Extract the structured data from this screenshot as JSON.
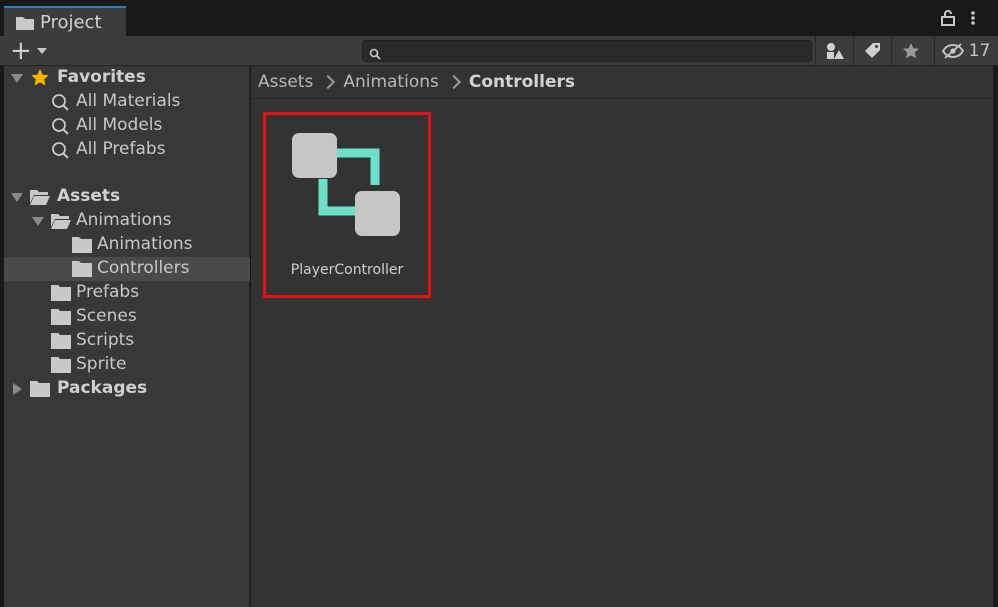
{
  "window": {
    "tab_title": "Project",
    "icons": [
      "folder-icon",
      "lock-icon",
      "kebab-menu-icon"
    ]
  },
  "toolbar": {
    "add_button": "+",
    "search": {
      "value": "",
      "placeholder": ""
    },
    "buttons": [
      "filter-by-type-icon",
      "filter-by-label-icon",
      "favorites-star-icon"
    ],
    "hidden_packages_count": "17"
  },
  "sidebar": {
    "favorites": {
      "label": "Favorites",
      "items": [
        "All Materials",
        "All Models",
        "All Prefabs"
      ]
    },
    "assets": {
      "label": "Assets",
      "animations": {
        "label": "Animations",
        "children": [
          "Animations",
          "Controllers"
        ],
        "selected": "Controllers"
      },
      "folders": [
        "Prefabs",
        "Scenes",
        "Scripts",
        "Sprite"
      ]
    },
    "packages": {
      "label": "Packages"
    }
  },
  "breadcrumb": [
    "Assets",
    "Animations",
    "Controllers"
  ],
  "assets_grid": [
    {
      "name": "PlayerController",
      "type": "animator-controller-icon",
      "highlighted": true
    }
  ],
  "colors": {
    "accent_tab": "#3a79bb",
    "highlight_box": "#e81010",
    "favorite_star": "#f4b400",
    "controller_link": "#6de0c8"
  }
}
